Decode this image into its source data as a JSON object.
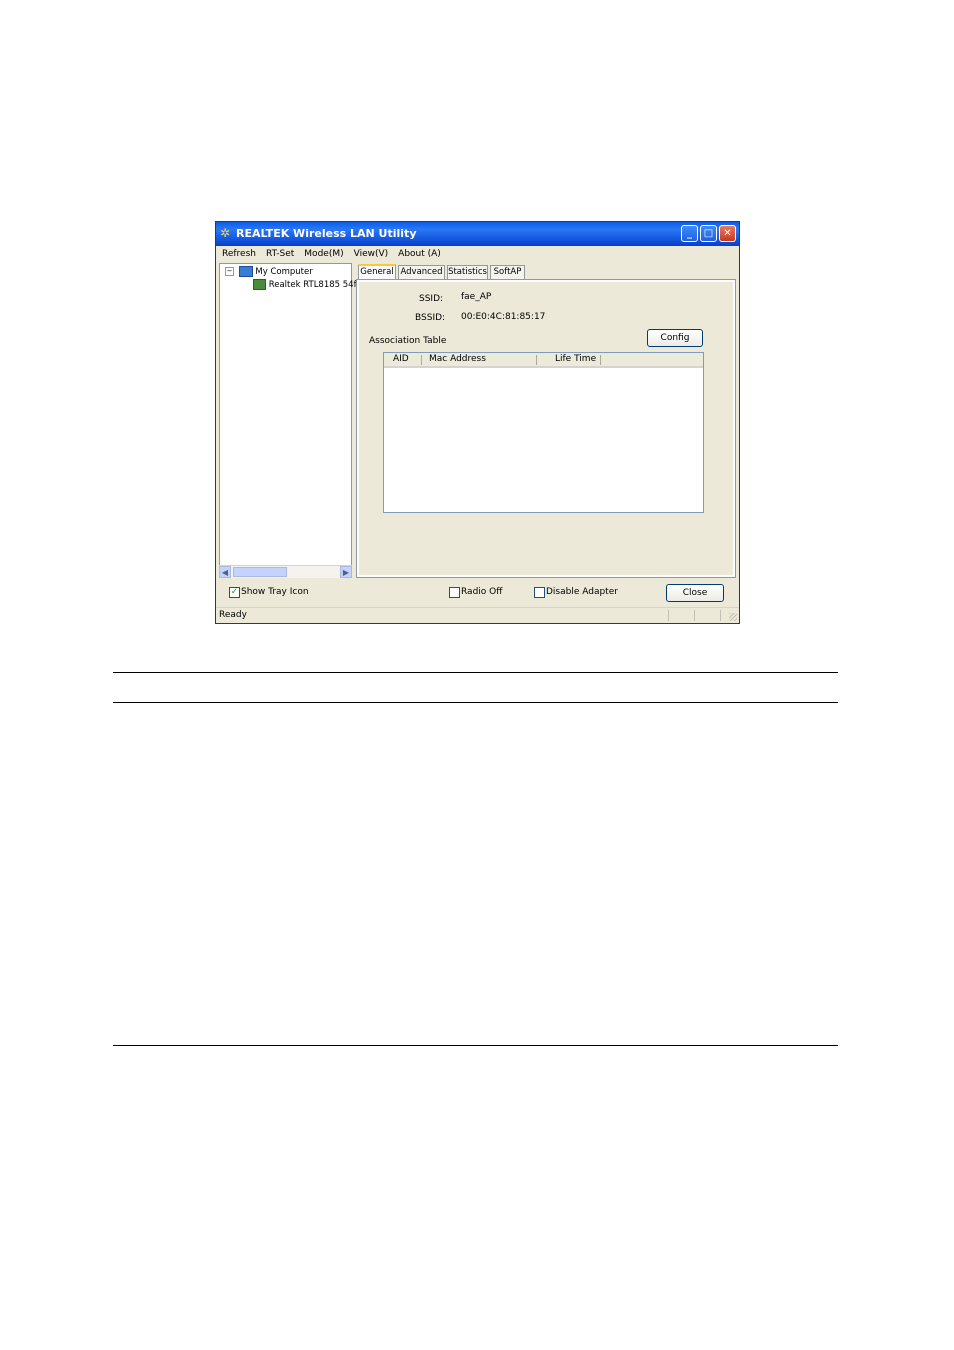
{
  "window": {
    "title": "REALTEK Wireless LAN Utility",
    "buttons": {
      "minimize": "_",
      "maximize": "□",
      "close": "✕"
    }
  },
  "menu": [
    "Refresh",
    "RT-Set",
    "Mode(M)",
    "View(V)",
    "About (A)"
  ],
  "tree": {
    "root_label": "My Computer",
    "child_label": "Realtek RTL8185 54f"
  },
  "tabs": [
    "General",
    "Advanced",
    "Statistics",
    "SoftAP"
  ],
  "active_tab": "General",
  "general": {
    "ssid_label": "SSID:",
    "ssid_value": "fae_AP",
    "bssid_label": "BSSID:",
    "bssid_value": "00:E0:4C:81:85:17",
    "config_button": "Config",
    "association_table_label": "Association Table",
    "columns": [
      "AID",
      "Mac Address",
      "Life Time"
    ]
  },
  "bottom": {
    "show_tray_icon": "Show Tray Icon",
    "show_tray_checked": true,
    "radio_off": "Radio Off",
    "radio_off_checked": false,
    "disable_adapter": "Disable Adapter",
    "disable_adapter_checked": false,
    "close_button": "Close"
  },
  "status": "Ready",
  "colors": {
    "titlebar": "#0a5de8",
    "face": "#ece9d8",
    "tab_highlight": "#ffc83c"
  }
}
